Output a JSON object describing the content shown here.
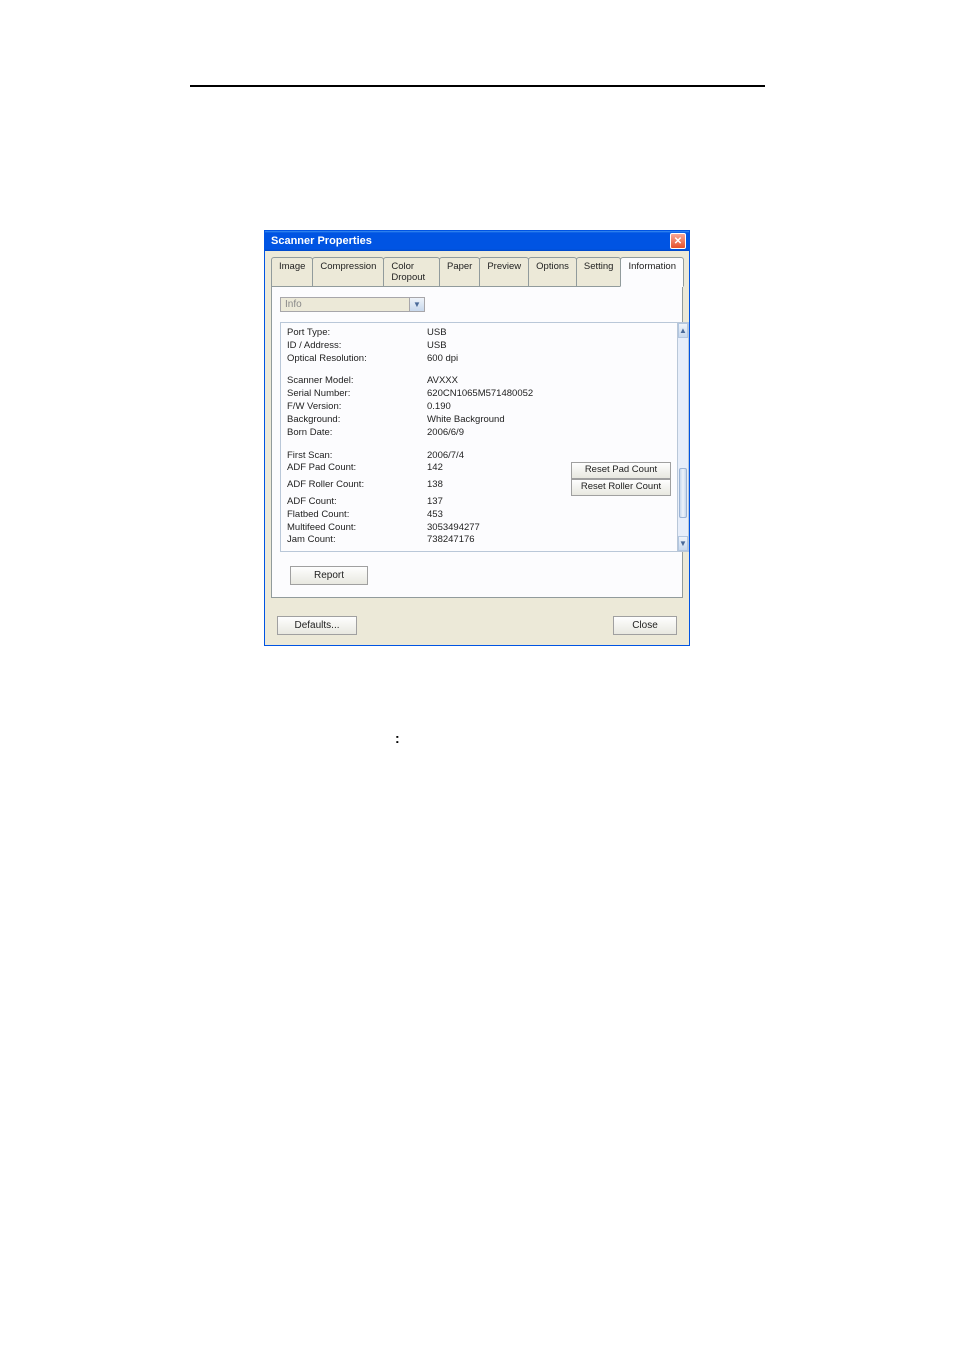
{
  "window": {
    "title": "Scanner Properties",
    "tabs": [
      "Image",
      "Compression",
      "Color Dropout",
      "Paper",
      "Preview",
      "Options",
      "Setting",
      "Information"
    ],
    "activeTab": "Information",
    "dropdown": {
      "label": "Info"
    },
    "info": {
      "group1": [
        {
          "label": "Port Type",
          "value": "USB"
        },
        {
          "label": "ID / Address",
          "value": "USB"
        },
        {
          "label": "Optical Resolution",
          "value": "600 dpi"
        }
      ],
      "group2": [
        {
          "label": "Scanner Model",
          "value": "AVXXX"
        },
        {
          "label": "Serial Number",
          "value": "620CN1065M571480052"
        },
        {
          "label": "F/W Version",
          "value": "0.190"
        },
        {
          "label": "Background",
          "value": "White Background"
        },
        {
          "label": "Born Date",
          "value": "2006/6/9"
        }
      ],
      "group3": [
        {
          "label": "First Scan",
          "value": "2006/7/4",
          "button": null
        },
        {
          "label": "ADF Pad Count",
          "value": "142",
          "button": "Reset Pad Count"
        },
        {
          "label": "ADF Roller Count",
          "value": "138",
          "button": "Reset Roller Count"
        },
        {
          "label": "ADF Count",
          "value": "137",
          "button": null
        },
        {
          "label": "Flatbed Count",
          "value": "453",
          "button": null
        },
        {
          "label": "Multifeed Count",
          "value": "3053494277",
          "button": null
        },
        {
          "label": "Jam Count",
          "value": "738247176",
          "button": null
        }
      ]
    },
    "buttons": {
      "report": "Report",
      "defaults": "Defaults...",
      "close": "Close"
    }
  }
}
